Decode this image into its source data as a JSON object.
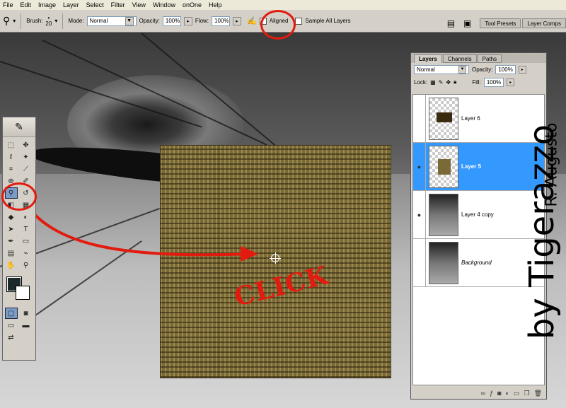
{
  "menubar": {
    "items": [
      "File",
      "Edit",
      "Image",
      "Layer",
      "Select",
      "Filter",
      "View",
      "Window",
      "onOne",
      "Help"
    ]
  },
  "options": {
    "brush_label": "Brush:",
    "brush_size": "20",
    "mode_label": "Mode:",
    "mode_value": "Normal",
    "opacity_label": "Opacity:",
    "opacity_value": "100%",
    "flow_label": "Flow:",
    "flow_value": "100%",
    "aligned_label": "Aligned",
    "sample_all_label": "Sample All Layers",
    "tool_presets_tab": "Tool Presets",
    "layer_comps_tab": "Layer Comps"
  },
  "layers_panel": {
    "tabs": [
      "Layers",
      "Channels",
      "Paths"
    ],
    "blend_mode": "Normal",
    "opacity_label": "Opacity:",
    "opacity_value": "100%",
    "lock_label": "Lock:",
    "fill_label": "Fill:",
    "fill_value": "100%",
    "layers": [
      {
        "name": "Layer 6",
        "visible": false,
        "active": false
      },
      {
        "name": "Layer 5",
        "visible": true,
        "active": true
      },
      {
        "name": "Layer 4 copy",
        "visible": true,
        "active": false
      },
      {
        "name": "Background",
        "visible": false,
        "active": false
      }
    ]
  },
  "annotations": {
    "click_text": "CLICK",
    "signature_main": "by Tigerazzo",
    "signature_sub": "R. Augusto",
    "accent_color": "#e21b0e",
    "selection_color": "#3399ff"
  },
  "colors": {
    "foreground": "#1d2a2b",
    "background": "#ffffff"
  }
}
